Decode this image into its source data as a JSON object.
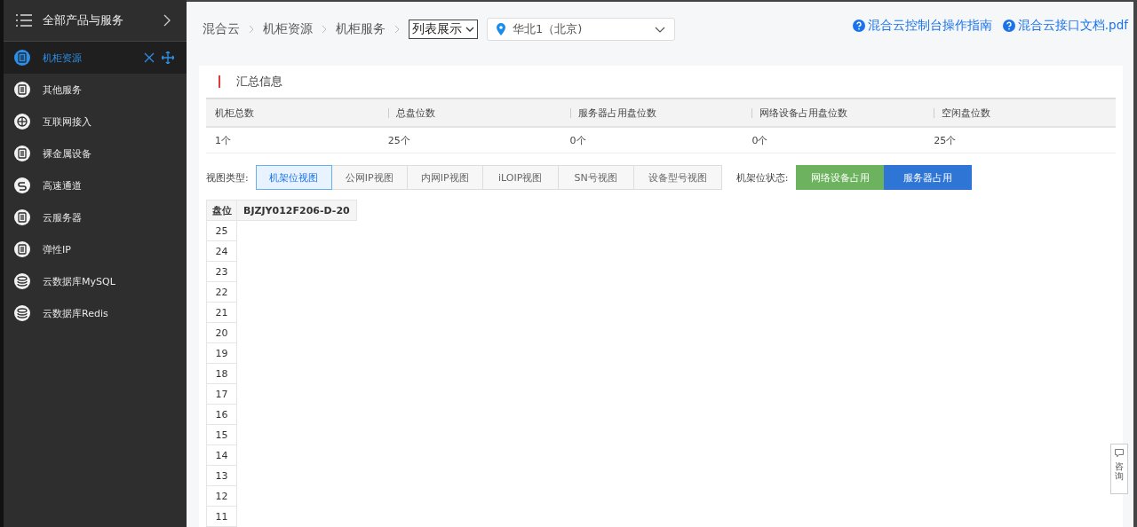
{
  "sidebar": {
    "title": "全部产品与服务",
    "items": [
      {
        "label": "机柜资源",
        "selected": true
      },
      {
        "label": "其他服务",
        "selected": false
      },
      {
        "label": "互联网接入",
        "selected": false
      },
      {
        "label": "裸金属设备",
        "selected": false
      },
      {
        "label": "高速通道",
        "selected": false
      },
      {
        "label": "云服务器",
        "selected": false
      },
      {
        "label": "弹性IP",
        "selected": false
      },
      {
        "label": "云数据库MySQL",
        "selected": false
      },
      {
        "label": "云数据库Redis",
        "selected": false
      }
    ]
  },
  "breadcrumb": [
    "混合云",
    "机柜资源",
    "机柜服务"
  ],
  "display_select": {
    "value": "列表展示"
  },
  "region_select": {
    "value": "华北1（北京)"
  },
  "help_links": [
    "混合云控制台操作指南",
    "混合云接口文档.pdf"
  ],
  "summary": {
    "title": "汇总信息",
    "columns": [
      "机柜总数",
      "总盘位数",
      "服务器占用盘位数",
      "网络设备占用盘位数",
      "空闲盘位数"
    ],
    "values": [
      "1个",
      "25个",
      "0个",
      "0个",
      "25个"
    ]
  },
  "view_type": {
    "label": "视图类型:",
    "tabs": [
      {
        "label": "机架位视图",
        "selected": true
      },
      {
        "label": "公网IP视图",
        "selected": false
      },
      {
        "label": "内网IP视图",
        "selected": false
      },
      {
        "label": "iLOIP视图",
        "selected": false
      },
      {
        "label": "SN号视图",
        "selected": false
      },
      {
        "label": "设备型号视图",
        "selected": false
      }
    ]
  },
  "rack_status": {
    "label": "机架位状态:",
    "legend": [
      {
        "label": "网络设备占用",
        "color": "#6db35f"
      },
      {
        "label": "服务器占用",
        "color": "#2f75d6"
      }
    ]
  },
  "rack_table": {
    "columns": [
      "盘位",
      "BJZJY012F206-D-20"
    ],
    "slots": [
      "25",
      "24",
      "23",
      "22",
      "21",
      "20",
      "19",
      "18",
      "17",
      "16",
      "15",
      "14",
      "13",
      "12",
      "11"
    ]
  },
  "consult_button": {
    "label": "咨询"
  }
}
